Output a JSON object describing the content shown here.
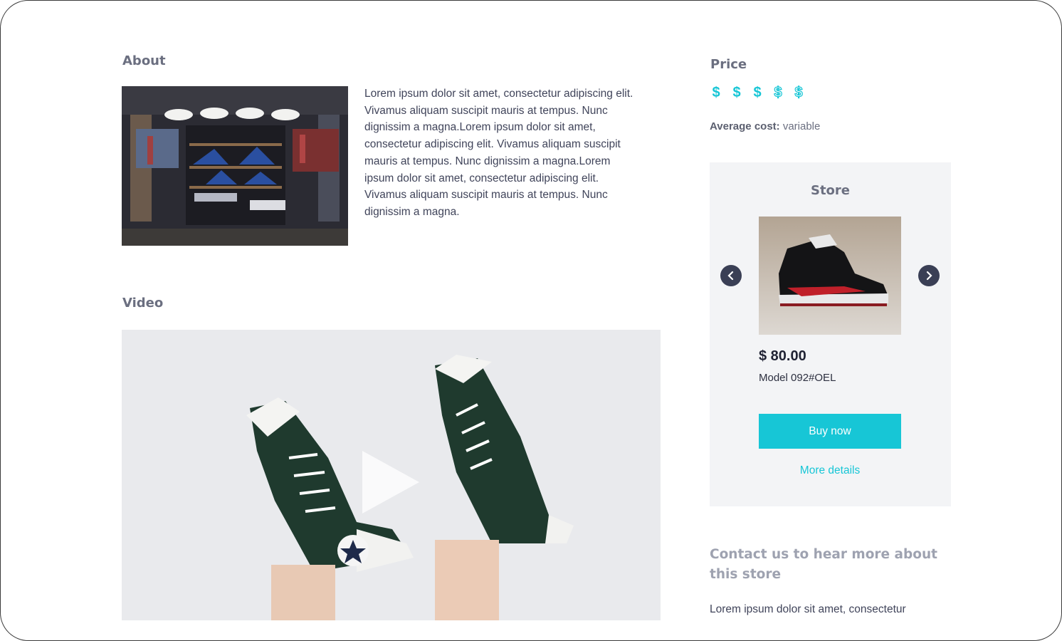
{
  "about": {
    "title": "About",
    "text": "Lorem ipsum dolor sit amet, consectetur adipiscing elit. Vivamus aliquam suscipit mauris at tempus. Nunc dignissim a magna.Lorem ipsum dolor sit amet, consectetur adipiscing elit. Vivamus aliquam suscipit mauris at tempus. Nunc dignissim a magna.Lorem ipsum dolor sit amet, consectetur adipiscing elit. Vivamus aliquam suscipit mauris at tempus. Nunc dignissim a magna."
  },
  "video": {
    "title": "Video"
  },
  "price": {
    "title": "Price",
    "level": 3,
    "max": 5,
    "symbol": "$",
    "average_label": "Average cost:",
    "average_value": "variable"
  },
  "store": {
    "title": "Store",
    "product_price": "$ 80.00",
    "product_model": "Model 092#OEL",
    "buy_label": "Buy now",
    "details_label": "More details"
  },
  "contact": {
    "title": "Contact us to hear more about this store",
    "text": "Lorem ipsum dolor sit amet, consectetur"
  },
  "colors": {
    "accent": "#17c6d6",
    "heading": "#6b6f80",
    "dark_button": "#3a3f55",
    "card_bg": "#f3f4f6"
  }
}
